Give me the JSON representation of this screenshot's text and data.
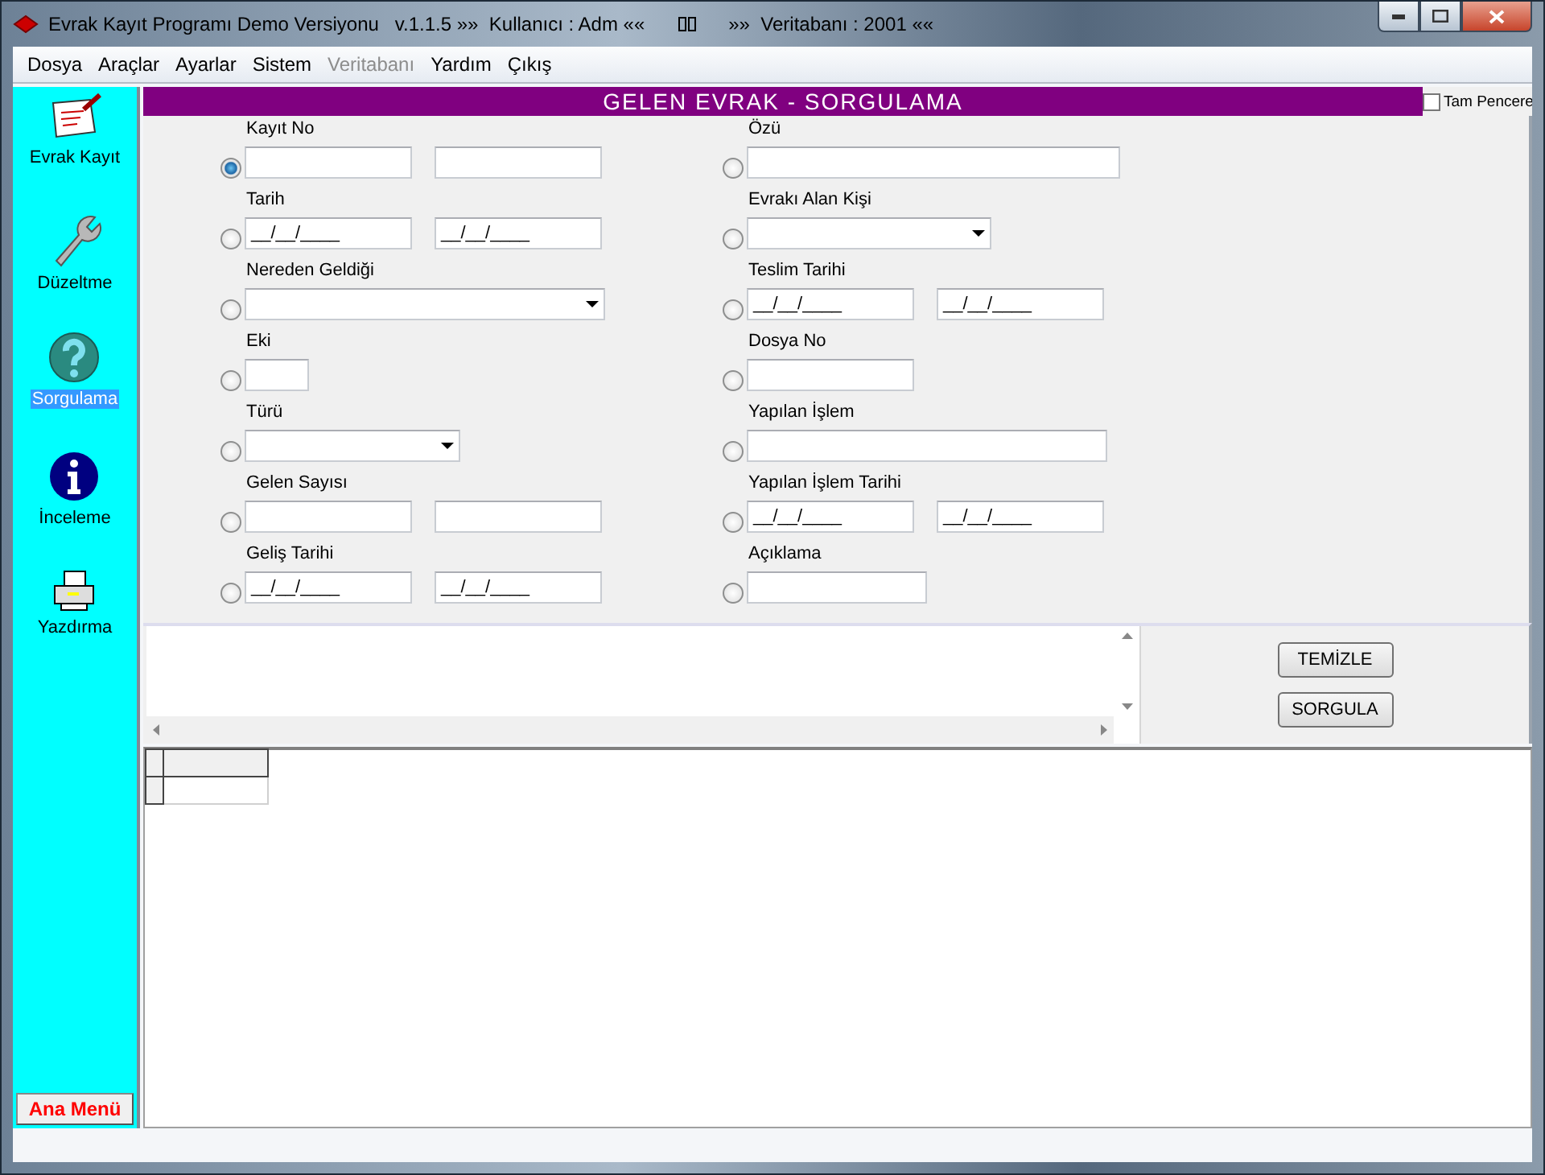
{
  "window": {
    "title": "Evrak Kayıt Programı Demo Versiyonu   v.1.1.5 »»  Kullanıcı : Adm ««",
    "title_right": "»»  Veritabanı : 2001 ««"
  },
  "menu": [
    {
      "label": "Dosya",
      "disabled": false
    },
    {
      "label": "Araçlar",
      "disabled": false
    },
    {
      "label": "Ayarlar",
      "disabled": false
    },
    {
      "label": "Sistem",
      "disabled": false
    },
    {
      "label": "Veritabanı",
      "disabled": true
    },
    {
      "label": "Yardım",
      "disabled": false
    },
    {
      "label": "Çıkış",
      "disabled": false
    }
  ],
  "sidebar": {
    "items": [
      {
        "label": "Evrak Kayıt",
        "kind": "paper",
        "selected": false
      },
      {
        "label": "Düzeltme",
        "kind": "wrench",
        "selected": false
      },
      {
        "label": "Sorgulama",
        "kind": "question",
        "selected": true
      },
      {
        "label": "İnceleme",
        "kind": "info",
        "selected": false
      },
      {
        "label": "Yazdırma",
        "kind": "printer",
        "selected": false
      }
    ],
    "main_menu_button": "Ana Menü"
  },
  "header": {
    "title": "GELEN EVRAK - SORGULAMA",
    "full_window": {
      "label": "Tam Pencere",
      "checked": false
    }
  },
  "form": {
    "columns": [
      [
        {
          "label": "Kayıt No",
          "selected": true,
          "inputs": [
            {
              "kind": "text"
            },
            {
              "kind": "text"
            }
          ]
        },
        {
          "label": "Tarih",
          "selected": false,
          "inputs": [
            {
              "kind": "date",
              "value": "__/__/____"
            },
            {
              "kind": "date",
              "value": "__/__/____"
            }
          ]
        },
        {
          "label": "Nereden Geldiği",
          "selected": false,
          "inputs": [
            {
              "kind": "combo"
            }
          ]
        },
        {
          "label": "Eki",
          "selected": false,
          "inputs": [
            {
              "kind": "text"
            }
          ]
        },
        {
          "label": "Türü",
          "selected": false,
          "inputs": [
            {
              "kind": "combo"
            }
          ]
        },
        {
          "label": "Gelen Sayısı",
          "selected": false,
          "inputs": [
            {
              "kind": "text"
            },
            {
              "kind": "text"
            }
          ]
        },
        {
          "label": "Geliş Tarihi",
          "selected": false,
          "inputs": [
            {
              "kind": "date",
              "value": "__/__/____"
            },
            {
              "kind": "date",
              "value": "__/__/____"
            }
          ]
        }
      ],
      [
        {
          "label": "Özü",
          "selected": false,
          "inputs": [
            {
              "kind": "text"
            }
          ]
        },
        {
          "label": "Evrakı Alan Kişi",
          "selected": false,
          "inputs": [
            {
              "kind": "combo"
            }
          ]
        },
        {
          "label": "Teslim Tarihi",
          "selected": false,
          "inputs": [
            {
              "kind": "date",
              "value": "__/__/____"
            },
            {
              "kind": "date",
              "value": "__/__/____"
            }
          ]
        },
        {
          "label": "Dosya No",
          "selected": false,
          "inputs": [
            {
              "kind": "text"
            }
          ]
        },
        {
          "label": "Yapılan İşlem",
          "selected": false,
          "inputs": [
            {
              "kind": "text"
            }
          ]
        },
        {
          "label": "Yapılan İşlem Tarihi",
          "selected": false,
          "inputs": [
            {
              "kind": "date",
              "value": "__/__/____"
            },
            {
              "kind": "date",
              "value": "__/__/____"
            }
          ]
        },
        {
          "label": "Açıklama",
          "selected": false,
          "inputs": [
            {
              "kind": "text"
            }
          ]
        }
      ]
    ]
  },
  "buttons": [
    "TEMİZLE",
    "SORGULA"
  ]
}
